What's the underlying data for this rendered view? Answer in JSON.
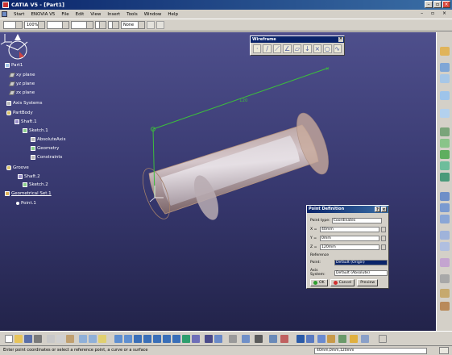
{
  "window": {
    "title": "CATIA V5 - [Part1]"
  },
  "menu": {
    "items": [
      "Start",
      "ENOVIA V5",
      "File",
      "Edit",
      "View",
      "Insert",
      "Tools",
      "Window",
      "Help"
    ],
    "mdi_controls": "– ▫ ×"
  },
  "format_toolbar": {
    "zoom": "100%",
    "layer": "None"
  },
  "tree": {
    "root": "Part1",
    "nodes": [
      {
        "label": "xy plane"
      },
      {
        "label": "yz plane"
      },
      {
        "label": "zx plane"
      },
      {
        "label": "Axis Systems"
      },
      {
        "label": "PartBody"
      },
      {
        "label": "Shaft.1"
      },
      {
        "label": "Sketch.1"
      },
      {
        "label": "AbsoluteAxis"
      },
      {
        "label": "Geometry"
      },
      {
        "label": "Constraints"
      },
      {
        "label": "Groove"
      },
      {
        "label": "Shaft.2"
      },
      {
        "label": "Sketch.2"
      },
      {
        "label": "Geometrical Set.1"
      },
      {
        "label": "Point.1"
      }
    ]
  },
  "wireframe_toolbar": {
    "title": "Wireframe",
    "close": "×"
  },
  "viewport": {
    "dimension": "120"
  },
  "point_dialog": {
    "title": "Point Definition",
    "help": "?",
    "close": "×",
    "point_type_label": "Point type:",
    "point_type": "Coordinates",
    "x_label": "X =",
    "x_value": "40mm",
    "y_label": "Y =",
    "y_value": "0mm",
    "z_label": "Z =",
    "z_value": "120mm",
    "reference_label": "Reference",
    "point_label": "Point:",
    "point_value": "Default (Origin)",
    "axis_label": "Axis System:",
    "axis_value": "Default (Absolute)",
    "ok": "OK",
    "cancel": "Cancel",
    "preview": "Preview"
  },
  "status": {
    "message": "Enter point coordinates or select a reference point, a curve or a surface",
    "command": "40mm,0mm,120mm"
  },
  "colors": {
    "viewport_top": "#4e4f8c",
    "viewport_bottom": "#22234a",
    "selection": "#0a246a",
    "sketch_green": "#3cbd3c"
  }
}
